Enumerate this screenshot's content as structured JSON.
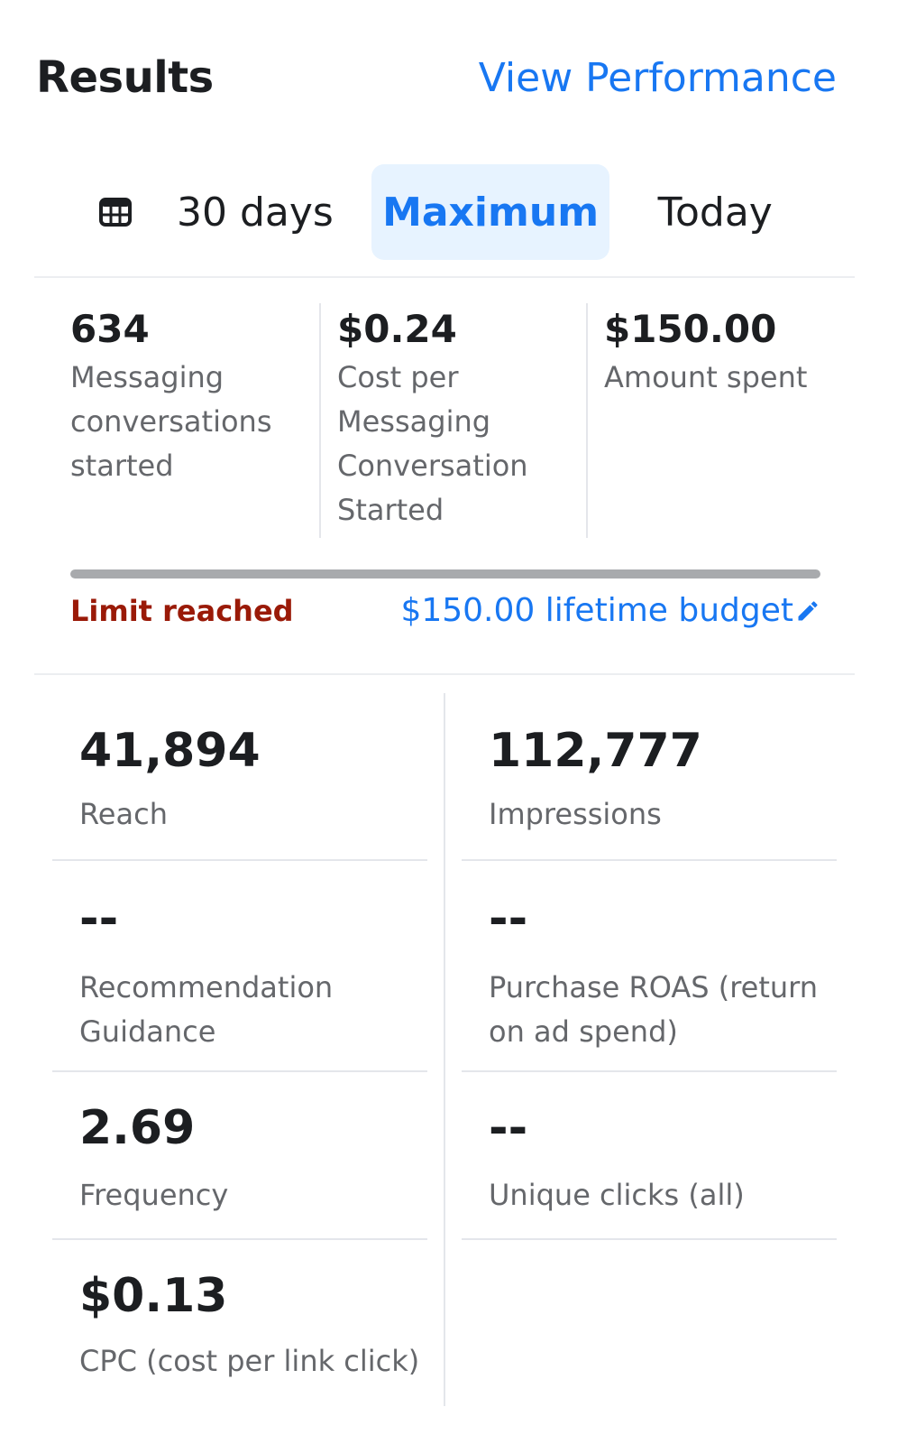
{
  "header": {
    "title": "Results",
    "view_link": "View Performance"
  },
  "date_range": {
    "options": [
      {
        "label": "30 days",
        "icon": "calendar-icon"
      },
      {
        "label": "Maximum",
        "selected": true
      },
      {
        "label": "Today"
      }
    ]
  },
  "summary": [
    {
      "value": "634",
      "label": "Messaging conversations started"
    },
    {
      "value": "$0.24",
      "label": "Cost per Messaging Conversation Started"
    },
    {
      "value": "$150.00",
      "label": "Amount spent"
    }
  ],
  "budget": {
    "progress_fraction": 1.0,
    "limit_text": "Limit reached",
    "budget_text": "$150.00 lifetime budget",
    "edit_icon": "pencil-icon",
    "colors": {
      "limit": "#9a1a08",
      "link": "#1877f2"
    }
  },
  "metrics": {
    "reach": {
      "value": "41,894",
      "label": "Reach"
    },
    "impressions": {
      "value": "112,777",
      "label": "Impressions"
    },
    "recommendation": {
      "value": "--",
      "label": "Recommendation Guidance"
    },
    "roas": {
      "value": "--",
      "label": "Purchase ROAS (return on ad spend)"
    },
    "frequency": {
      "value": "2.69",
      "label": "Frequency"
    },
    "unique_clicks": {
      "value": "--",
      "label": "Unique clicks (all)"
    },
    "cpc": {
      "value": "$0.13",
      "label": "CPC (cost per link click)"
    }
  }
}
